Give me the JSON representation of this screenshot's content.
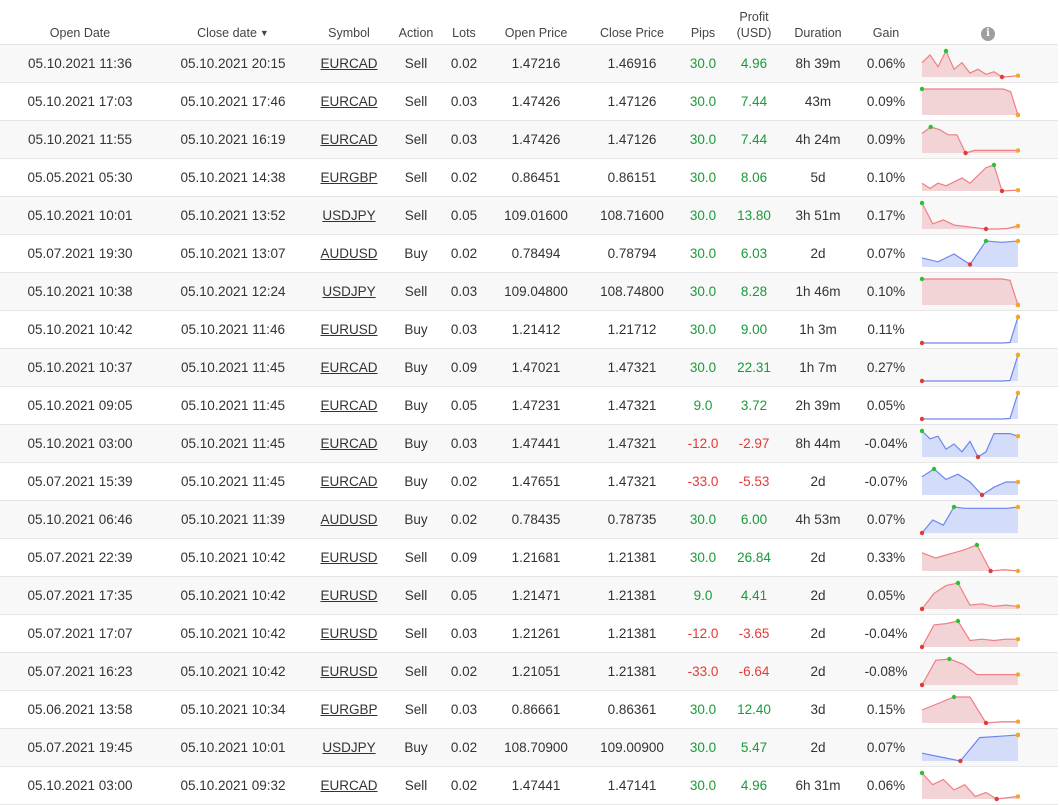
{
  "headers": {
    "open_date": "Open Date",
    "close_date": "Close date",
    "close_sort_indicator": "▼",
    "symbol": "Symbol",
    "action": "Action",
    "lots": "Lots",
    "open_price": "Open Price",
    "close_price": "Close Price",
    "pips": "Pips",
    "profit_line1": "Profit",
    "profit_line2": "(USD)",
    "duration": "Duration",
    "gain": "Gain",
    "info_glyph": "i"
  },
  "colors": {
    "positive": "#1a9a3a",
    "negative": "#e53935",
    "spark_sell_fill": "#f2d3d6",
    "spark_sell_line": "#ef7f86",
    "spark_buy_fill": "#d3ddfa",
    "spark_buy_line": "#6f86ef",
    "marker_high": "#2fbf2f",
    "marker_low": "#e53935",
    "marker_end": "#f5a623"
  },
  "rows": [
    {
      "open": "05.10.2021 11:36",
      "close": "05.10.2021 20:15",
      "symbol": "EURCAD",
      "action": "Sell",
      "lots": "0.02",
      "open_price": "1.47216",
      "close_price": "1.46916",
      "pips": "30.0",
      "profit": "4.96",
      "duration": "8h 39m",
      "gain": "0.06%",
      "spark": [
        0.55,
        0.85,
        0.4,
        1.0,
        0.3,
        0.55,
        0.15,
        0.3,
        0.1,
        0.2,
        0.0,
        0.02,
        0.05
      ]
    },
    {
      "open": "05.10.2021 17:03",
      "close": "05.10.2021 17:46",
      "symbol": "EURCAD",
      "action": "Sell",
      "lots": "0.03",
      "open_price": "1.47426",
      "close_price": "1.47126",
      "pips": "30.0",
      "profit": "7.44",
      "duration": "43m",
      "gain": "0.09%",
      "spark": [
        1.0,
        1.0,
        1.0,
        1.0,
        1.0,
        1.0,
        1.0,
        1.0,
        1.0,
        1.0,
        1.0,
        1.0,
        0.9,
        0.0
      ]
    },
    {
      "open": "05.10.2021 11:55",
      "close": "05.10.2021 16:19",
      "symbol": "EURCAD",
      "action": "Sell",
      "lots": "0.03",
      "open_price": "1.47426",
      "close_price": "1.47126",
      "pips": "30.0",
      "profit": "7.44",
      "duration": "4h 24m",
      "gain": "0.09%",
      "spark": [
        0.75,
        1.0,
        0.9,
        0.7,
        0.7,
        0.0,
        0.1,
        0.1,
        0.1,
        0.1,
        0.1,
        0.1
      ]
    },
    {
      "open": "05.05.2021 05:30",
      "close": "05.10.2021 14:38",
      "symbol": "EURGBP",
      "action": "Sell",
      "lots": "0.02",
      "open_price": "0.86451",
      "close_price": "0.86151",
      "pips": "30.0",
      "profit": "8.06",
      "duration": "5d",
      "gain": "0.10%",
      "spark": [
        0.3,
        0.1,
        0.3,
        0.2,
        0.35,
        0.5,
        0.3,
        0.6,
        0.9,
        1.0,
        0.0,
        0.02,
        0.03
      ]
    },
    {
      "open": "05.10.2021 10:01",
      "close": "05.10.2021 13:52",
      "symbol": "USDJPY",
      "action": "Sell",
      "lots": "0.05",
      "open_price": "109.01600",
      "close_price": "108.71600",
      "pips": "30.0",
      "profit": "13.80",
      "duration": "3h 51m",
      "gain": "0.17%",
      "spark": [
        1.0,
        0.2,
        0.35,
        0.15,
        0.1,
        0.05,
        0.0,
        0.0,
        0.02,
        0.12
      ]
    },
    {
      "open": "05.07.2021 19:30",
      "close": "05.10.2021 13:07",
      "symbol": "AUDUSD",
      "action": "Buy",
      "lots": "0.02",
      "open_price": "0.78494",
      "close_price": "0.78794",
      "pips": "30.0",
      "profit": "6.03",
      "duration": "2d",
      "gain": "0.07%",
      "spark": [
        0.35,
        0.2,
        0.5,
        0.1,
        1.0,
        0.95,
        1.0
      ]
    },
    {
      "open": "05.10.2021 10:38",
      "close": "05.10.2021 12:24",
      "symbol": "USDJPY",
      "action": "Sell",
      "lots": "0.03",
      "open_price": "109.04800",
      "close_price": "108.74800",
      "pips": "30.0",
      "profit": "8.28",
      "duration": "1h 46m",
      "gain": "0.10%",
      "spark": [
        1.0,
        1.0,
        1.0,
        1.0,
        1.0,
        1.0,
        1.0,
        1.0,
        1.0,
        1.0,
        1.0,
        0.95,
        0.0
      ]
    },
    {
      "open": "05.10.2021 10:42",
      "close": "05.10.2021 11:46",
      "symbol": "EURUSD",
      "action": "Buy",
      "lots": "0.03",
      "open_price": "1.21412",
      "close_price": "1.21712",
      "pips": "30.0",
      "profit": "9.00",
      "duration": "1h 3m",
      "gain": "0.11%",
      "spark": [
        0.0,
        0.0,
        0.0,
        0.0,
        0.0,
        0.0,
        0.0,
        0.0,
        0.0,
        0.0,
        0.0,
        0.02,
        1.0
      ]
    },
    {
      "open": "05.10.2021 10:37",
      "close": "05.10.2021 11:45",
      "symbol": "EURCAD",
      "action": "Buy",
      "lots": "0.09",
      "open_price": "1.47021",
      "close_price": "1.47321",
      "pips": "30.0",
      "profit": "22.31",
      "duration": "1h 7m",
      "gain": "0.27%",
      "spark": [
        0.0,
        0.0,
        0.0,
        0.0,
        0.0,
        0.0,
        0.0,
        0.0,
        0.0,
        0.0,
        0.0,
        0.02,
        1.0
      ]
    },
    {
      "open": "05.10.2021 09:05",
      "close": "05.10.2021 11:45",
      "symbol": "EURCAD",
      "action": "Buy",
      "lots": "0.05",
      "open_price": "1.47231",
      "close_price": "1.47321",
      "pips": "9.0",
      "profit": "3.72",
      "duration": "2h 39m",
      "gain": "0.05%",
      "spark": [
        0.0,
        0.0,
        0.0,
        0.0,
        0.0,
        0.0,
        0.0,
        0.0,
        0.0,
        0.0,
        0.0,
        0.02,
        1.0
      ]
    },
    {
      "open": "05.10.2021 03:00",
      "close": "05.10.2021 11:45",
      "symbol": "EURCAD",
      "action": "Buy",
      "lots": "0.03",
      "open_price": "1.47441",
      "close_price": "1.47321",
      "pips": "-12.0",
      "profit": "-2.97",
      "duration": "8h 44m",
      "gain": "-0.04%",
      "spark": [
        1.0,
        0.7,
        0.8,
        0.3,
        0.5,
        0.2,
        0.6,
        0.0,
        0.2,
        0.9,
        0.9,
        0.9,
        0.8
      ]
    },
    {
      "open": "05.07.2021 15:39",
      "close": "05.10.2021 11:45",
      "symbol": "EURCAD",
      "action": "Buy",
      "lots": "0.02",
      "open_price": "1.47651",
      "close_price": "1.47321",
      "pips": "-33.0",
      "profit": "-5.53",
      "duration": "2d",
      "gain": "-0.07%",
      "spark": [
        0.7,
        1.0,
        0.6,
        0.8,
        0.5,
        0.0,
        0.3,
        0.5,
        0.5
      ]
    },
    {
      "open": "05.10.2021 06:46",
      "close": "05.10.2021 11:39",
      "symbol": "AUDUSD",
      "action": "Buy",
      "lots": "0.02",
      "open_price": "0.78435",
      "close_price": "0.78735",
      "pips": "30.0",
      "profit": "6.00",
      "duration": "4h 53m",
      "gain": "0.07%",
      "spark": [
        0.0,
        0.5,
        0.3,
        1.0,
        0.95,
        0.95,
        0.95,
        0.95,
        0.95,
        1.0
      ]
    },
    {
      "open": "05.07.2021 22:39",
      "close": "05.10.2021 10:42",
      "symbol": "EURUSD",
      "action": "Sell",
      "lots": "0.09",
      "open_price": "1.21681",
      "close_price": "1.21381",
      "pips": "30.0",
      "profit": "26.84",
      "duration": "2d",
      "gain": "0.33%",
      "spark": [
        0.7,
        0.5,
        0.65,
        0.8,
        1.0,
        0.0,
        0.05,
        0.0
      ]
    },
    {
      "open": "05.07.2021 17:35",
      "close": "05.10.2021 10:42",
      "symbol": "EURUSD",
      "action": "Sell",
      "lots": "0.05",
      "open_price": "1.21471",
      "close_price": "1.21381",
      "pips": "9.0",
      "profit": "4.41",
      "duration": "2d",
      "gain": "0.05%",
      "spark": [
        0.0,
        0.6,
        0.9,
        1.0,
        0.15,
        0.2,
        0.1,
        0.15,
        0.1
      ]
    },
    {
      "open": "05.07.2021 17:07",
      "close": "05.10.2021 10:42",
      "symbol": "EURUSD",
      "action": "Sell",
      "lots": "0.03",
      "open_price": "1.21261",
      "close_price": "1.21381",
      "pips": "-12.0",
      "profit": "-3.65",
      "duration": "2d",
      "gain": "-0.04%",
      "spark": [
        0.0,
        0.85,
        0.9,
        1.0,
        0.25,
        0.3,
        0.25,
        0.3,
        0.3
      ]
    },
    {
      "open": "05.07.2021 16:23",
      "close": "05.10.2021 10:42",
      "symbol": "EURUSD",
      "action": "Sell",
      "lots": "0.02",
      "open_price": "1.21051",
      "close_price": "1.21381",
      "pips": "-33.0",
      "profit": "-6.64",
      "duration": "2d",
      "gain": "-0.08%",
      "spark": [
        0.0,
        0.95,
        1.0,
        0.8,
        0.4,
        0.4,
        0.4,
        0.4
      ]
    },
    {
      "open": "05.06.2021 13:58",
      "close": "05.10.2021 10:34",
      "symbol": "EURGBP",
      "action": "Sell",
      "lots": "0.03",
      "open_price": "0.86661",
      "close_price": "0.86361",
      "pips": "30.0",
      "profit": "12.40",
      "duration": "3d",
      "gain": "0.15%",
      "spark": [
        0.5,
        0.75,
        1.0,
        1.0,
        0.0,
        0.05,
        0.05
      ]
    },
    {
      "open": "05.07.2021 19:45",
      "close": "05.10.2021 10:01",
      "symbol": "USDJPY",
      "action": "Buy",
      "lots": "0.02",
      "open_price": "108.70900",
      "close_price": "109.00900",
      "pips": "30.0",
      "profit": "5.47",
      "duration": "2d",
      "gain": "0.07%",
      "spark": [
        0.3,
        0.15,
        0.0,
        0.9,
        0.95,
        1.0
      ]
    },
    {
      "open": "05.10.2021 03:00",
      "close": "05.10.2021 09:32",
      "symbol": "EURCAD",
      "action": "Sell",
      "lots": "0.02",
      "open_price": "1.47441",
      "close_price": "1.47141",
      "pips": "30.0",
      "profit": "4.96",
      "duration": "6h 31m",
      "gain": "0.06%",
      "spark": [
        1.0,
        0.55,
        0.75,
        0.35,
        0.55,
        0.1,
        0.25,
        0.0,
        0.05,
        0.1
      ]
    }
  ]
}
